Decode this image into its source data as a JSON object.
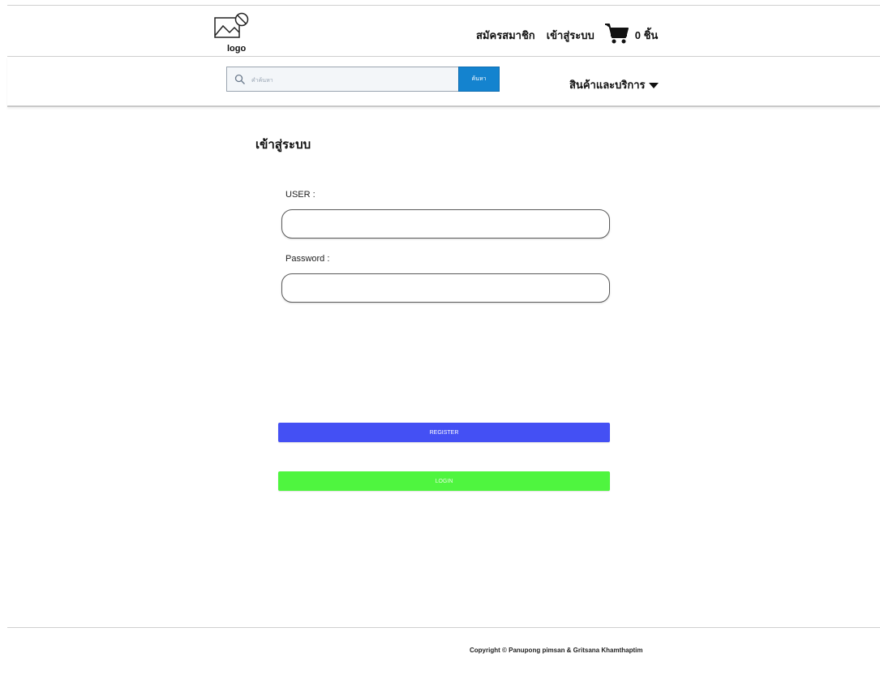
{
  "header": {
    "logo_label": "logo",
    "register_link": "สมัครสมาชิก",
    "login_link": "เข้าสู่ระบบ",
    "cart_count": "0 ชิ้น"
  },
  "nav": {
    "search_placeholder": "คำค้นหา",
    "search_button": "ค้นหา",
    "products_menu": "สินค้าและบริการ"
  },
  "main": {
    "title": "เข้าสู่ระบบ",
    "user_label": "USER :",
    "password_label": "Password :",
    "user_value": "",
    "password_value": "",
    "register_button": "REGISTER",
    "login_button": "LOGIN"
  },
  "footer": {
    "copyright": "Copyright © Panupong pimsan & Gritsana Khamthaptim"
  },
  "icons": {
    "logo": "image-placeholder-icon",
    "cart": "shopping-cart-icon",
    "search": "search-icon",
    "caret": "caret-down-icon"
  },
  "colors": {
    "search_button": "#1483cf",
    "register_button": "#4450f4",
    "login_button": "#4ff53f"
  }
}
